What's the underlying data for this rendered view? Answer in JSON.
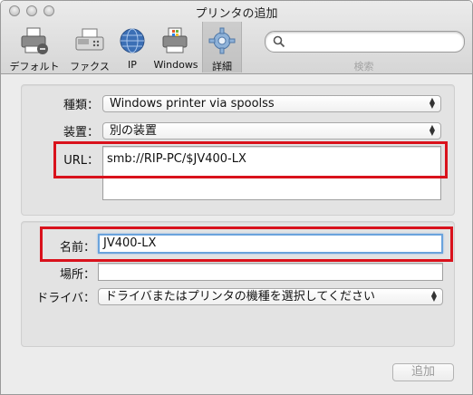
{
  "window": {
    "title": "プリンタの追加"
  },
  "toolbar": {
    "items": [
      {
        "label": "デフォルト",
        "icon": "printer-default-icon"
      },
      {
        "label": "ファクス",
        "icon": "fax-icon"
      },
      {
        "label": "IP",
        "icon": "globe-icon"
      },
      {
        "label": "Windows",
        "icon": "windows-printer-icon"
      },
      {
        "label": "詳細",
        "icon": "gear-icon",
        "selected": true
      }
    ],
    "search": {
      "placeholder": "",
      "caption": "検索"
    }
  },
  "advanced": {
    "type_label": "種類：",
    "type_value": "Windows printer via spoolss",
    "device_label": "装置：",
    "device_value": "別の装置",
    "url_label": "URL：",
    "url_value": "smb://RIP-PC/$JV400-LX"
  },
  "details": {
    "name_label": "名前：",
    "name_value": "JV400-LX",
    "location_label": "場所：",
    "location_value": "",
    "driver_label": "ドライバ：",
    "driver_value": "ドライバまたはプリンタの機種を選択してください"
  },
  "footer": {
    "add_label": "追加"
  },
  "colors": {
    "highlight": "#d9121c",
    "focus_ring": "#6aa3dc",
    "window_bg": "#ececec"
  }
}
